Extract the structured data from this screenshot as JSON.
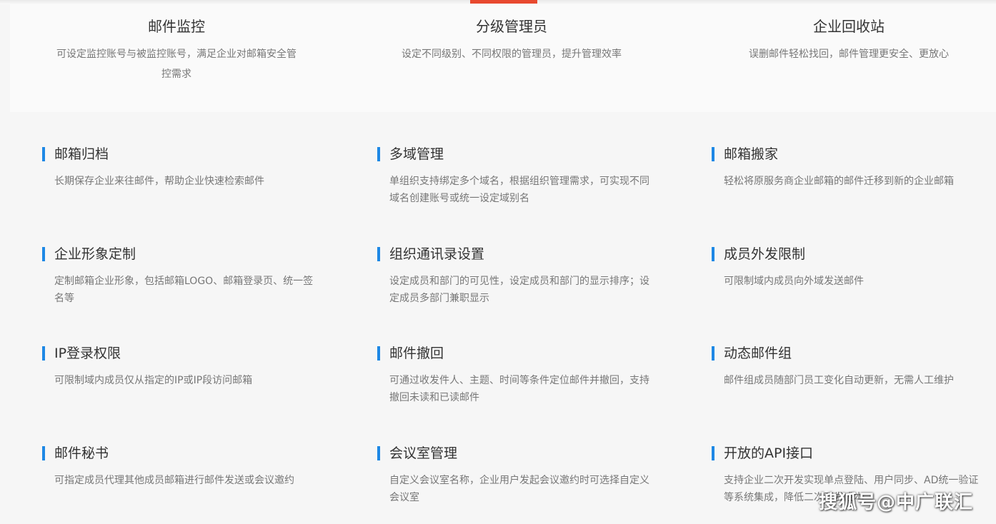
{
  "colors": {
    "accent_bar": "#1e88e5",
    "tab_indicator": "#e8492f"
  },
  "top_features": [
    {
      "title": "邮件监控",
      "desc": "可设定监控账号与被监控账号，满足企业对邮箱安全管控需求"
    },
    {
      "title": "分级管理员",
      "desc": "设定不同级别、不同权限的管理员，提升管理效率"
    },
    {
      "title": "企业回收站",
      "desc": "误删邮件轻松找回，邮件管理更安全、更放心"
    }
  ],
  "features": [
    {
      "title": "邮箱归档",
      "desc": "长期保存企业来往邮件，帮助企业快速检索邮件"
    },
    {
      "title": "多域管理",
      "desc": "单组织支持绑定多个域名，根据组织管理需求，可实现不同域名创建账号或统一设定域别名"
    },
    {
      "title": "邮箱搬家",
      "desc": "轻松将原服务商企业邮箱的邮件迁移到新的企业邮箱"
    },
    {
      "title": "企业形象定制",
      "desc": "定制邮箱企业形象，包括邮箱LOGO、邮箱登录页、统一签名等"
    },
    {
      "title": "组织通讯录设置",
      "desc": "设定成员和部门的可见性，设定成员和部门的显示排序；设定成员多部门兼职显示"
    },
    {
      "title": "成员外发限制",
      "desc": "可限制域内成员向外域发送邮件"
    },
    {
      "title": "IP登录权限",
      "desc": "可限制域内成员仅从指定的IP或IP段访问邮箱"
    },
    {
      "title": "邮件撤回",
      "desc": "可通过收发件人、主题、时间等条件定位邮件并撤回，支持撤回未读和已读邮件"
    },
    {
      "title": "动态邮件组",
      "desc": "邮件组成员随部门员工变化自动更新，无需人工维护"
    },
    {
      "title": "邮件秘书",
      "desc": "可指定成员代理其他成员邮箱进行邮件发送或会议邀约"
    },
    {
      "title": "会议室管理",
      "desc": "自定义会议室名称，企业用户发起会议邀约时可选择自定义会议室"
    },
    {
      "title": "开放的API接口",
      "desc": "支持企业二次开发实现单点登陆、用户同步、AD统一验证等系统集成，降低二次开发成本"
    }
  ],
  "watermark": "搜狐号@中广联汇"
}
